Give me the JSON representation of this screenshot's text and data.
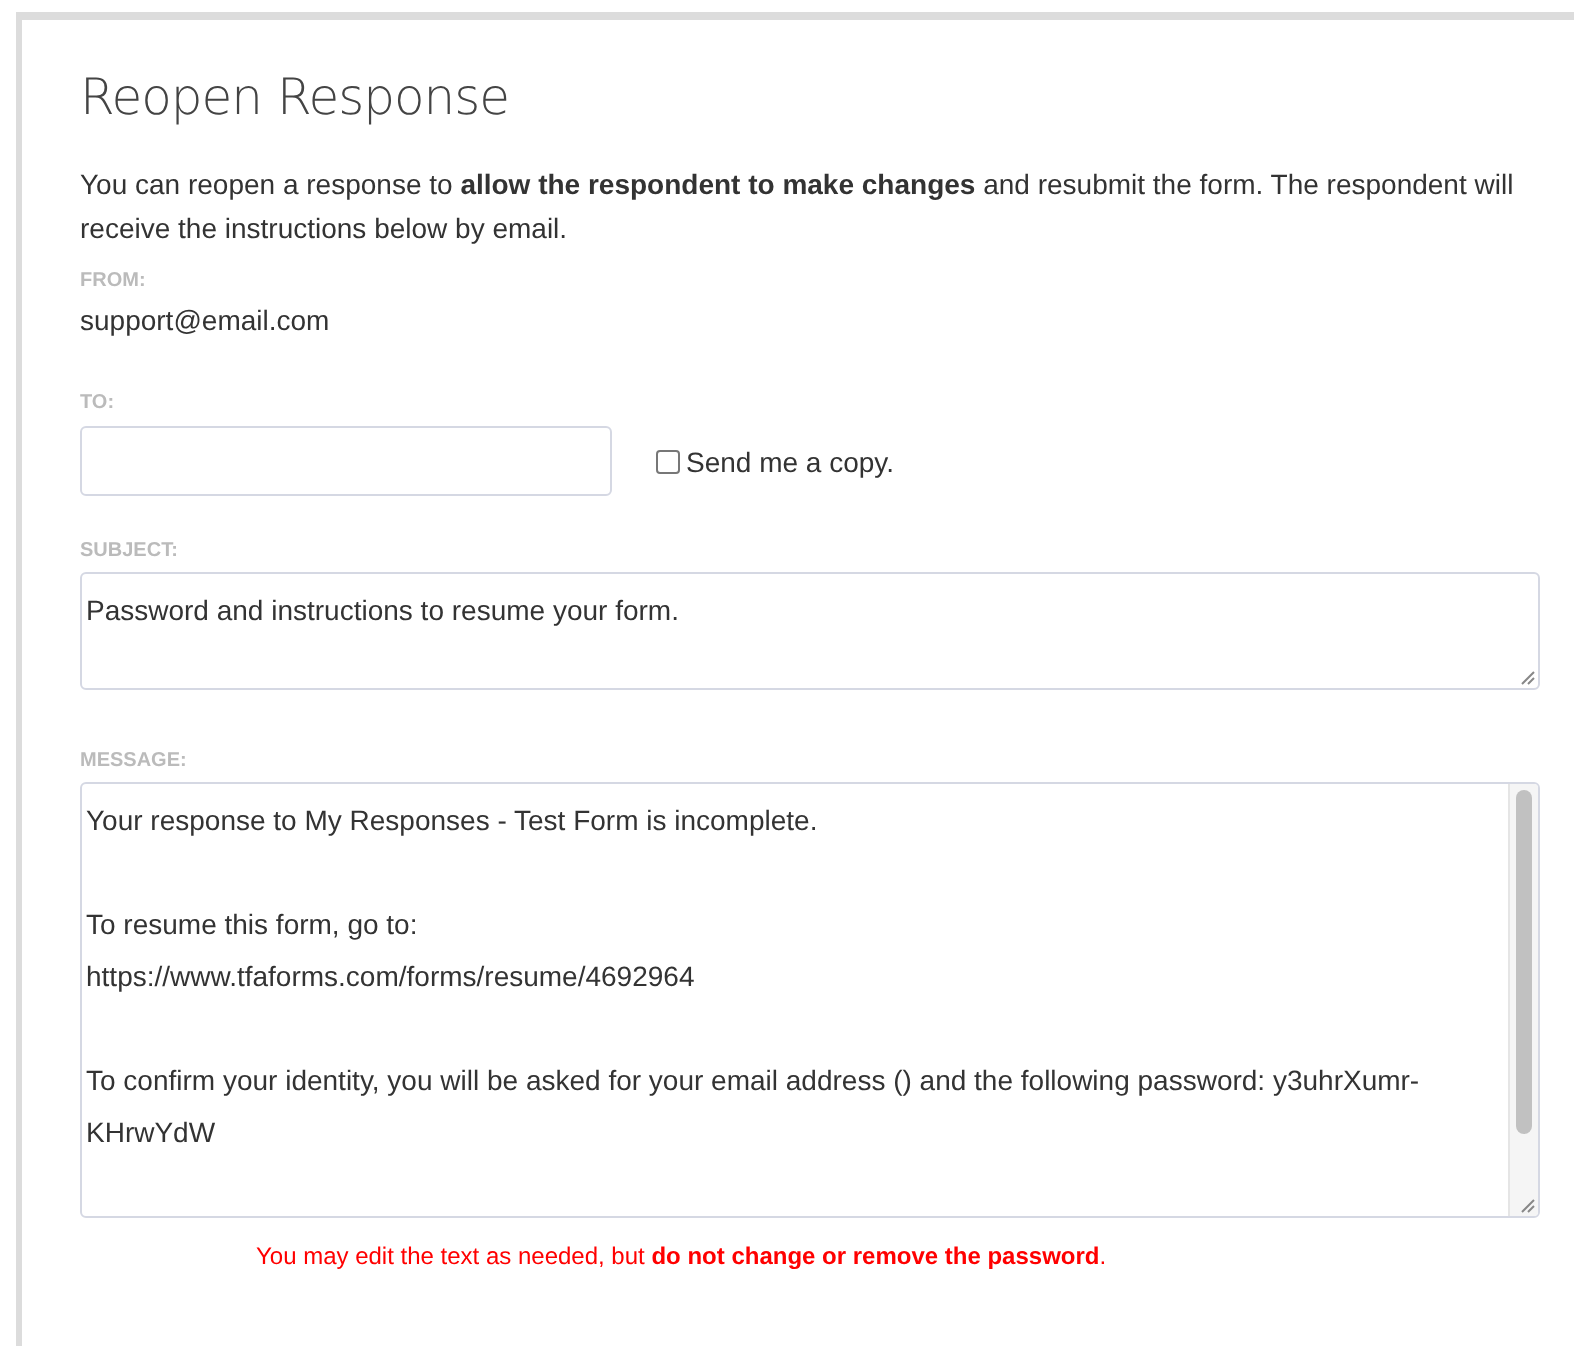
{
  "title": "Reopen Response",
  "intro": "You can reopen a response to **allow the respondent to make changes** and resubmit the form. The respondent will receive the instructions below by email.",
  "from": {
    "label": "FROM:",
    "value": "support@email.com"
  },
  "to": {
    "label": "TO:"
  },
  "send_copy": {
    "label": "Send me a copy.",
    "checked": false
  },
  "subject": {
    "label": "SUBJECT:",
    "value": "Password and instructions to resume your form."
  },
  "message": {
    "label": "MESSAGE:",
    "paragraphs": [
      "Your response to My Responses - Test Form is incomplete.",
      "To resume this form, go to:\nhttps://www.tfaforms.com/forms/resume/4692964",
      "To confirm your identity, you will be asked for your email address () and the following password: y3uhrXumr-KHrwYdW"
    ]
  },
  "note": "You may edit the text as needed, but **do not change or remove the password**."
}
